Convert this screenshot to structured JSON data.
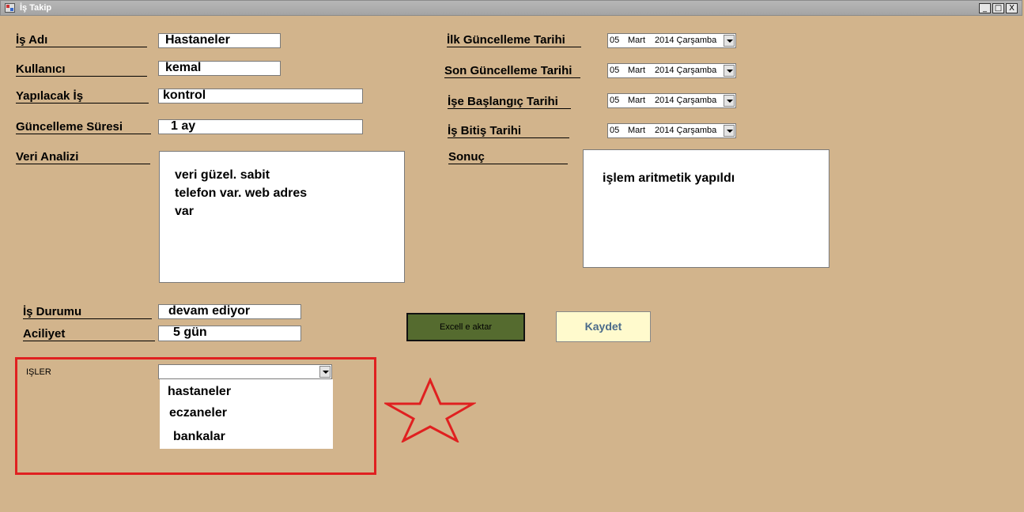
{
  "window": {
    "title": "İş Takip",
    "controls": {
      "minimize": "_",
      "maximize": "□",
      "close": "X"
    }
  },
  "form": {
    "is_adi": {
      "label": "İş Adı",
      "value": "Hastaneler"
    },
    "kullanici": {
      "label": "Kullanıcı",
      "value": "kemal"
    },
    "yapilacak_is": {
      "label": "Yapılacak İş",
      "value": "kontrol"
    },
    "guncelleme_suresi": {
      "label": "Güncelleme Süresi",
      "value": "1 ay"
    },
    "veri_analizi": {
      "label": "Veri Analizi",
      "value": "veri güzel. sabit\ntelefon var. web adres\nvar"
    },
    "sonuc": {
      "label": "Sonuç",
      "value": "işlem aritmetik yapıldı"
    },
    "is_durumu": {
      "label": "İş Durumu",
      "value": "devam ediyor"
    },
    "aciliyet": {
      "label": "Aciliyet",
      "value": "5 gün"
    }
  },
  "dates": [
    {
      "label": "İlk Güncelleme Tarihi",
      "day": "05",
      "month": "Mart",
      "rest": "2014 Çarşamba"
    },
    {
      "label": "Son Güncelleme Tarihi",
      "day": "05",
      "month": "Mart",
      "rest": "2014 Çarşamba"
    },
    {
      "label": "İşe Başlangıç Tarihi",
      "day": "05",
      "month": "Mart",
      "rest": "2014 Çarşamba"
    },
    {
      "label": "İş Bitiş Tarihi",
      "day": "05",
      "month": "Mart",
      "rest": "2014 Çarşamba"
    }
  ],
  "buttons": {
    "excel": "Excell e aktar",
    "kaydet": "Kaydet"
  },
  "isler": {
    "label": "IŞLER",
    "selected": "",
    "options": [
      "hastaneler",
      "eczaneler",
      "bankalar"
    ]
  },
  "colors": {
    "background": "#d2b48c",
    "excel_button": "#556b2f",
    "kaydet_button": "#fffacd",
    "highlight_frame": "#e02020",
    "star": "#e02020"
  },
  "icons": {
    "app": "app-icon",
    "star": "star-icon"
  }
}
